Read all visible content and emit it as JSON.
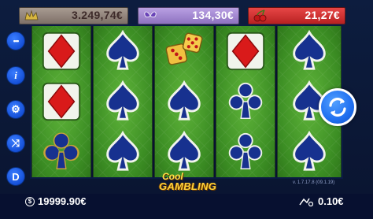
{
  "jackpots": [
    {
      "value": "3.249,74€",
      "icon": "crown-icon"
    },
    {
      "value": "134,30€",
      "icon": "butterfly-icon"
    },
    {
      "value": "21,27€",
      "icon": "cherry-icon"
    }
  ],
  "reels": [
    [
      "diamond",
      "diamond",
      "club"
    ],
    [
      "spade",
      "spade",
      "spade"
    ],
    [
      "dice",
      "spade",
      "spade"
    ],
    [
      "diamond",
      "club",
      "club"
    ],
    [
      "spade",
      "spade",
      "spade"
    ]
  ],
  "side_buttons": [
    {
      "name": "menu-button",
      "icon": "dots-icon",
      "label": "•••"
    },
    {
      "name": "info-button",
      "icon": "info-icon",
      "label": "i"
    },
    {
      "name": "settings-button",
      "icon": "gear-icon",
      "label": "⚙"
    },
    {
      "name": "autoplay-button",
      "icon": "shuffle-icon",
      "label": "⤨"
    },
    {
      "name": "d-button",
      "icon": "d-icon",
      "label": "D"
    }
  ],
  "logo": {
    "line1": "Cool",
    "line2": "GAMBLING"
  },
  "balance": {
    "value": "19999.90€",
    "icon": "dollar-coin-icon"
  },
  "bet": {
    "value": "0.10€",
    "icon": "bet-chips-icon"
  },
  "version": "v. 1.7.17.8 (09.1.19)",
  "colors": {
    "table_green": "#4ca32e",
    "diamond_red": "#d91a1a",
    "spade_blue": "#17318f",
    "accent_blue": "#1f6ff0",
    "gold": "#f2c14e"
  }
}
